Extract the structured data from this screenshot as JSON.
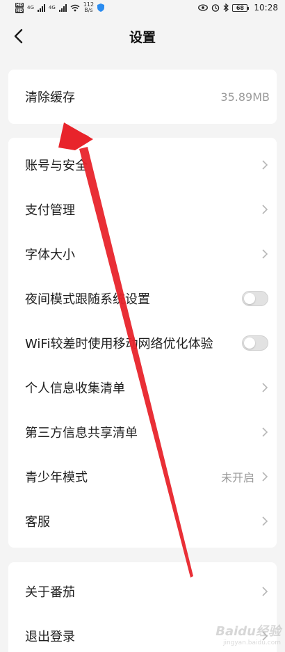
{
  "status_bar": {
    "hd_badges": [
      "HD",
      "HD"
    ],
    "network_labels": [
      "4G",
      "4G"
    ],
    "speed_value": "112",
    "speed_unit": "B/s",
    "battery": "68",
    "time": "10:28"
  },
  "nav": {
    "title": "设置"
  },
  "cache_card": {
    "label": "清除缓存",
    "value": "35.89MB"
  },
  "settings_items": [
    {
      "label": "账号与安全",
      "type": "chevron"
    },
    {
      "label": "支付管理",
      "type": "chevron"
    },
    {
      "label": "字体大小",
      "type": "chevron"
    },
    {
      "label": "夜间模式跟随系统设置",
      "type": "toggle",
      "on": false
    },
    {
      "label": "WiFi较差时使用移动网络优化体验",
      "type": "toggle",
      "on": false
    },
    {
      "label": "个人信息收集清单",
      "type": "chevron"
    },
    {
      "label": "第三方信息共享清单",
      "type": "chevron"
    },
    {
      "label": "青少年模式",
      "type": "chevron",
      "value": "未开启"
    },
    {
      "label": "客服",
      "type": "chevron"
    }
  ],
  "bottom_items": [
    {
      "label": "关于番茄"
    },
    {
      "label": "退出登录"
    }
  ],
  "watermark": {
    "logo": "Baidu经验",
    "url": "jingyan.baidu.com"
  },
  "colors": {
    "background": "#f4f4f4",
    "card": "#ffffff",
    "annotation_arrow": "#e8242b",
    "secondary_text": "#9a9a9a"
  }
}
